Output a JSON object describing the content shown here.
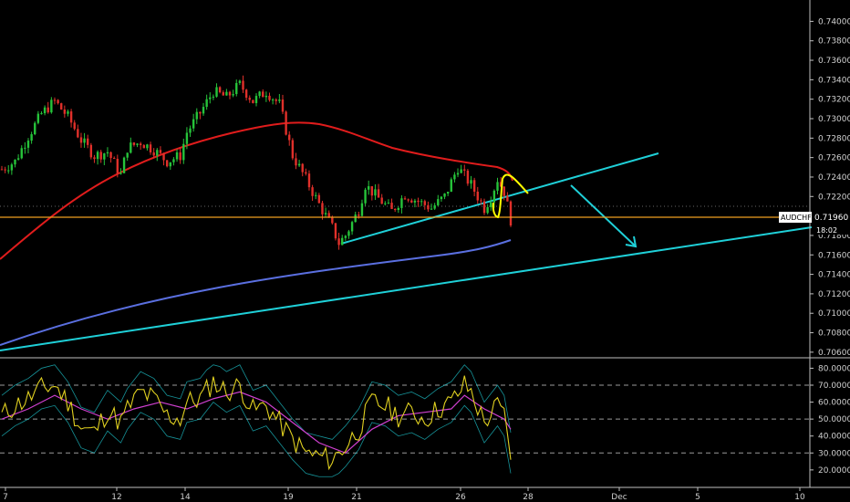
{
  "colors": {
    "background": "#000000",
    "up_candle": "#26c33a",
    "down_candle": "#e0302a",
    "ma_slow": "#e01c1c",
    "ma_blue": "#5a6fe0",
    "trendline": "#1fd0d8",
    "price_line": "#f0a020",
    "highlight": "#ffff00",
    "rsi": "#e0d020",
    "rsi_ma": "#d040d0",
    "grid": "#444444",
    "axis_text": "#d0d0d0"
  },
  "chart_data": [
    {
      "type": "candlestick",
      "symbol": "AUDCHF",
      "last_price": "0.71960",
      "countdown": "18:02",
      "price_axis": {
        "ticks": [
          "0.74000",
          "0.73800",
          "0.73600",
          "0.73400",
          "0.73200",
          "0.73000",
          "0.72800",
          "0.72600",
          "0.72400",
          "0.72200",
          "0.72000",
          "0.71800",
          "0.71600",
          "0.71400",
          "0.71200",
          "0.71000",
          "0.70800",
          "0.70600"
        ],
        "ylim": [
          0.7058,
          0.7406
        ]
      },
      "x_axis": {
        "ticks": [
          "7",
          "12",
          "14",
          "19",
          "21",
          "26",
          "28",
          "Dec",
          "5",
          "10"
        ]
      },
      "close_path": [
        [
          0,
          0.7248
        ],
        [
          4,
          0.7256
        ],
        [
          8,
          0.7282
        ],
        [
          12,
          0.7305
        ],
        [
          16,
          0.7318
        ],
        [
          20,
          0.7302
        ],
        [
          24,
          0.7278
        ],
        [
          28,
          0.7262
        ],
        [
          32,
          0.7266
        ],
        [
          36,
          0.7242
        ],
        [
          38,
          0.727
        ],
        [
          42,
          0.7276
        ],
        [
          46,
          0.7268
        ],
        [
          50,
          0.7256
        ],
        [
          54,
          0.7262
        ],
        [
          56,
          0.7286
        ],
        [
          60,
          0.7306
        ],
        [
          64,
          0.7328
        ],
        [
          68,
          0.7322
        ],
        [
          72,
          0.7335
        ],
        [
          76,
          0.7318
        ],
        [
          80,
          0.7328
        ],
        [
          84,
          0.7315
        ],
        [
          88,
          0.7262
        ],
        [
          92,
          0.7238
        ],
        [
          96,
          0.7212
        ],
        [
          100,
          0.7188
        ],
        [
          102,
          0.7172
        ],
        [
          104,
          0.718
        ],
        [
          108,
          0.7206
        ],
        [
          110,
          0.7232
        ],
        [
          114,
          0.7218
        ],
        [
          118,
          0.7205
        ],
        [
          122,
          0.7222
        ],
        [
          126,
          0.7215
        ],
        [
          130,
          0.7208
        ],
        [
          134,
          0.722
        ],
        [
          138,
          0.725
        ],
        [
          142,
          0.7232
        ],
        [
          146,
          0.7208
        ],
        [
          148,
          0.722
        ],
        [
          150,
          0.7238
        ],
        [
          152,
          0.7225
        ],
        [
          154,
          0.7196
        ]
      ],
      "indicator": {
        "type": "line",
        "y_axis_ticks": [
          "80.0000",
          "70.0000",
          "60.0000",
          "50.0000",
          "40.0000",
          "30.0000",
          "20.0000"
        ],
        "ylim": [
          14,
          84
        ],
        "levels": [
          70,
          50,
          30
        ],
        "rsi_path": [
          [
            0,
            52
          ],
          [
            4,
            58
          ],
          [
            8,
            62
          ],
          [
            12,
            68
          ],
          [
            16,
            70
          ],
          [
            20,
            60
          ],
          [
            24,
            45
          ],
          [
            28,
            42
          ],
          [
            32,
            55
          ],
          [
            36,
            48
          ],
          [
            38,
            56
          ],
          [
            42,
            66
          ],
          [
            46,
            62
          ],
          [
            50,
            52
          ],
          [
            54,
            50
          ],
          [
            56,
            60
          ],
          [
            60,
            62
          ],
          [
            64,
            72
          ],
          [
            68,
            66
          ],
          [
            72,
            70
          ],
          [
            76,
            55
          ],
          [
            80,
            58
          ],
          [
            84,
            48
          ],
          [
            88,
            38
          ],
          [
            92,
            30
          ],
          [
            96,
            28
          ],
          [
            100,
            26
          ],
          [
            104,
            34
          ],
          [
            108,
            44
          ],
          [
            112,
            60
          ],
          [
            116,
            58
          ],
          [
            120,
            52
          ],
          [
            124,
            54
          ],
          [
            128,
            50
          ],
          [
            132,
            56
          ],
          [
            136,
            60
          ],
          [
            140,
            70
          ],
          [
            142,
            66
          ],
          [
            146,
            48
          ],
          [
            150,
            58
          ],
          [
            152,
            52
          ],
          [
            154,
            30
          ]
        ],
        "rsi_ma_path": [
          [
            0,
            50
          ],
          [
            8,
            56
          ],
          [
            16,
            64
          ],
          [
            24,
            56
          ],
          [
            32,
            50
          ],
          [
            40,
            56
          ],
          [
            48,
            60
          ],
          [
            56,
            56
          ],
          [
            64,
            62
          ],
          [
            72,
            66
          ],
          [
            80,
            60
          ],
          [
            88,
            48
          ],
          [
            96,
            36
          ],
          [
            104,
            30
          ],
          [
            112,
            44
          ],
          [
            120,
            52
          ],
          [
            128,
            54
          ],
          [
            136,
            56
          ],
          [
            140,
            64
          ],
          [
            146,
            56
          ],
          [
            152,
            50
          ],
          [
            154,
            44
          ]
        ]
      }
    }
  ]
}
